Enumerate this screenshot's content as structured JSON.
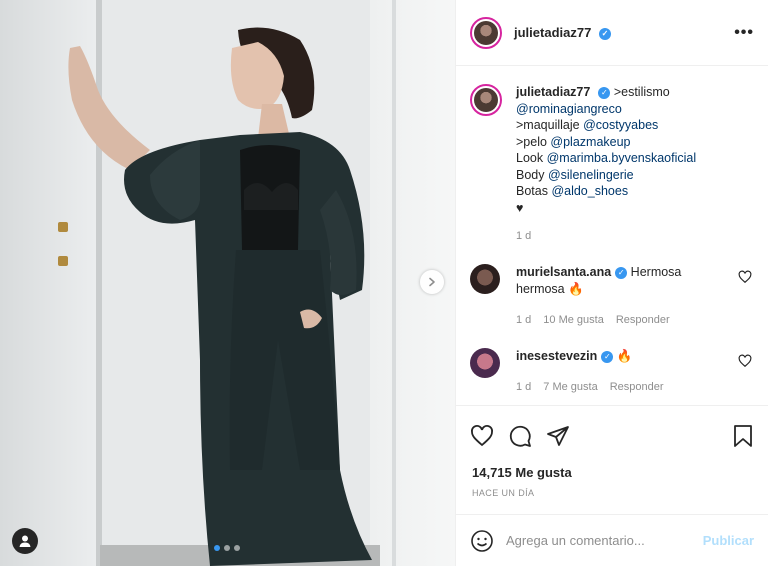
{
  "header": {
    "username": "julietadiaz77",
    "more_label": "•••"
  },
  "caption": {
    "username": "julietadiaz77",
    "lines": [
      {
        "prefix": ">estilismo",
        "mention": ""
      },
      {
        "prefix": "",
        "mention": "@rominagiangreco"
      },
      {
        "prefix": ">maquillaje ",
        "mention": "@costyyabes"
      },
      {
        "prefix": ">pelo ",
        "mention": "@plazmakeup"
      },
      {
        "prefix": "Look ",
        "mention": "@marimba.byvenskaoficial"
      },
      {
        "prefix": "Body ",
        "mention": "@silenelingerie"
      },
      {
        "prefix": "Botas ",
        "mention": "@aldo_shoes"
      },
      {
        "prefix": "♥",
        "mention": ""
      }
    ],
    "time": "1 d"
  },
  "comments": [
    {
      "username": "murielsanta.ana",
      "text": "Hermosa hermosa 🔥",
      "time": "1 d",
      "likes": "10 Me gusta",
      "reply": "Responder",
      "avatar_color": "#3b2b2a"
    },
    {
      "username": "inesestevezin",
      "text": "🔥",
      "time": "1 d",
      "likes": "7 Me gusta",
      "reply": "Responder",
      "avatar_color": "#6a3a6b"
    }
  ],
  "stats": {
    "likes": "14,715 Me gusta",
    "date": "HACE UN DÍA"
  },
  "add_comment": {
    "placeholder": "Agrega un comentario...",
    "post_label": "Publicar"
  },
  "icons": [
    "heart-icon",
    "comment-icon",
    "share-icon",
    "bookmark-icon",
    "emoji-icon",
    "user-tag-icon",
    "chevron-right-icon"
  ],
  "colors": {
    "accent": "#3897f0",
    "mention": "#00376b",
    "muted": "#8e8e8e"
  },
  "carousel": {
    "total": 3,
    "active": 1
  }
}
